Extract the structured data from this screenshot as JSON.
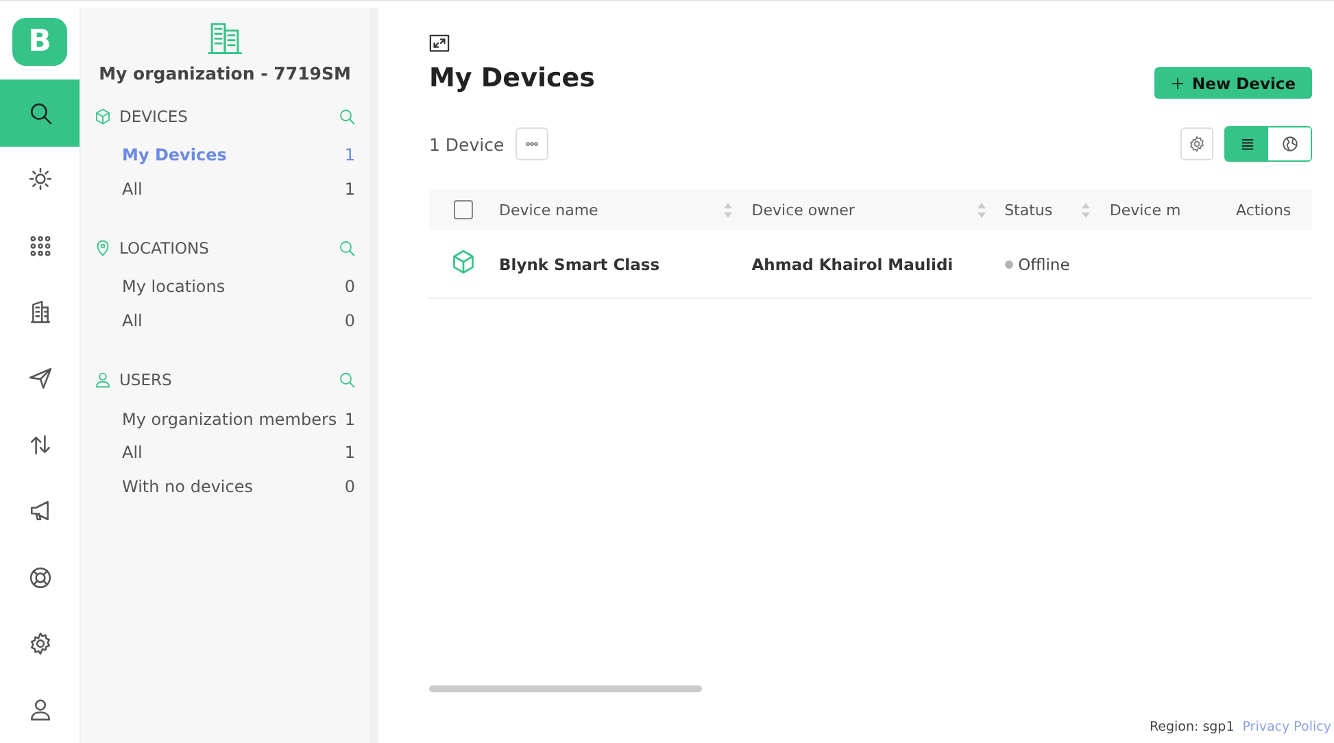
{
  "logo": {
    "letter": "B"
  },
  "rail": [
    {
      "kind": "search",
      "selected": true
    },
    {
      "kind": "sun",
      "selected": false
    },
    {
      "kind": "grid",
      "selected": false
    },
    {
      "kind": "building",
      "selected": false
    },
    {
      "kind": "send",
      "selected": false
    },
    {
      "kind": "arrows",
      "selected": false
    },
    {
      "kind": "megaphone",
      "selected": false
    },
    {
      "kind": "lifebuoy",
      "selected": false
    },
    {
      "kind": "gear",
      "selected": false
    },
    {
      "kind": "user",
      "selected": false
    }
  ],
  "sidebar": {
    "organization": "My organization - 7719SM",
    "sections": [
      {
        "kind": "cube",
        "title": "DEVICES",
        "items": [
          {
            "label": "My Devices",
            "count": "1",
            "selected": true
          },
          {
            "label": "All",
            "count": "1",
            "selected": false
          }
        ]
      },
      {
        "kind": "pin",
        "title": "LOCATIONS",
        "items": [
          {
            "label": "My locations",
            "count": "0",
            "selected": false
          },
          {
            "label": "All",
            "count": "0",
            "selected": false
          }
        ]
      },
      {
        "kind": "user",
        "title": "USERS",
        "items": [
          {
            "label": "My organization members",
            "count": "1",
            "selected": false
          },
          {
            "label": "All",
            "count": "1",
            "selected": false
          },
          {
            "label": "With no devices",
            "count": "0",
            "selected": false
          }
        ]
      }
    ]
  },
  "main": {
    "title": "My Devices",
    "new_button": "New Device",
    "count": "1 Device",
    "views": [
      {
        "kind": "list",
        "selected": true
      },
      {
        "kind": "map",
        "selected": false
      }
    ],
    "table": {
      "select_all": {
        "checked": false
      },
      "columns": [
        {
          "label": "Device name",
          "sortable": true
        },
        {
          "label": "Device owner",
          "sortable": true
        },
        {
          "label": "Status",
          "sortable": true
        },
        {
          "label": "Device m",
          "sortable": false
        },
        {
          "label": "Actions",
          "sortable": false
        }
      ],
      "rows": [
        {
          "name": "Blynk Smart Class",
          "owner": "Ahmad Khairol Maulidi",
          "status": "Offline",
          "color": "#b4b4b4"
        }
      ]
    }
  },
  "footer": {
    "region": "Region: sgp1",
    "link": "Privacy Policy"
  }
}
